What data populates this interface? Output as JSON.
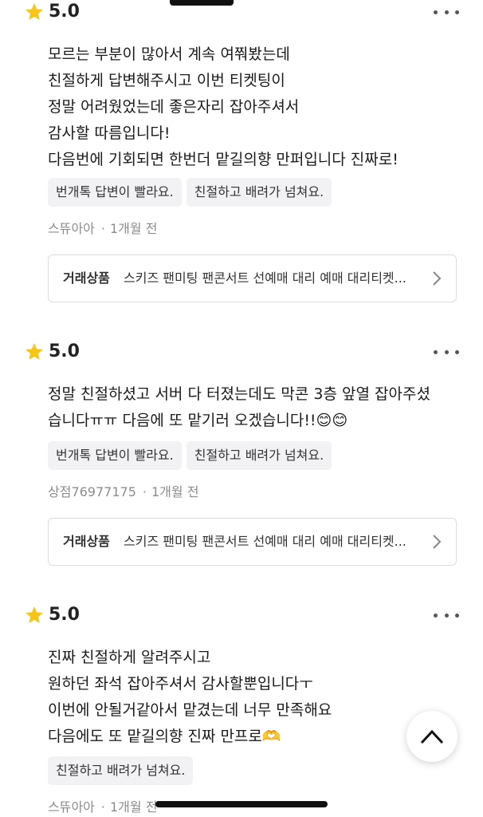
{
  "reviews": [
    {
      "score": "5.0",
      "body": "모르는 부분이 많아서 계속 여쭤봤는데\n친절하게 답변해주시고 이번 티켓팅이\n정말 어려웠었는데 좋은자리 잡아주셔서\n감사할 따름입니다!\n다음번에 기회되면 한번더 맡길의향 만퍼입니다 진짜로!",
      "tags": [
        "번개톡 답변이 빨라요.",
        "친절하고 배려가 넘쳐요."
      ],
      "author": "스뜌아아",
      "time": "1개월 전",
      "product_label": "거래상품",
      "product_name": "스키즈 팬미팅 팬콘서트 선예매 대리 예매 대리티켓..."
    },
    {
      "score": "5.0",
      "body": "정말 친절하셨고 서버 다 터졌는데도 막콘 3층 앞열 잡아주셨\n습니다ㅠㅠ 다음에 또 맡기러 오겠습니다!!😊😊",
      "tags": [
        "번개톡 답변이 빨라요.",
        "친절하고 배려가 넘쳐요."
      ],
      "author": "상점76977175",
      "time": "1개월 전",
      "product_label": "거래상품",
      "product_name": "스키즈 팬미팅 팬콘서트 선예매 대리 예매 대리티켓..."
    },
    {
      "score": "5.0",
      "body": "진짜 친절하게 알려주시고\n원하던 좌석 잡아주셔서 감사할뿐입니다ㅜ\n이번에 안될거같아서 맡겼는데 너무 만족해요\n다음에도 또 맡길의향 진짜 만프로🫶",
      "tags": [
        "친절하고 배려가 넘쳐요."
      ],
      "author": "스뜌아아",
      "time": "1개월 전"
    }
  ],
  "meta_separator": "·",
  "icons": {
    "star": "star-icon",
    "more": "more-icon",
    "chevron": "chevron-right-icon",
    "scroll_top": "chevron-up-icon"
  },
  "colors": {
    "star": "#F5C518",
    "tag_bg": "#F2F2F4",
    "meta": "#8C8C8C"
  }
}
